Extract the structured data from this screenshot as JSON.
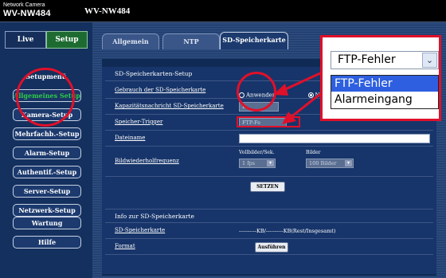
{
  "brand": {
    "sub": "Network Camera",
    "model": "WV-NW484"
  },
  "page_title": "WV-NW484",
  "mode": {
    "live": "Live",
    "setup": "Setup"
  },
  "nav": {
    "heading": "Setupmenü",
    "items": [
      {
        "label": "Allgemeines Setup"
      },
      {
        "label": "Kamera-Setup"
      },
      {
        "label": "Mehrfachb.-Setup"
      },
      {
        "label": "Alarm-Setup"
      },
      {
        "label": "Authentif.-Setup"
      },
      {
        "label": "Server-Setup"
      },
      {
        "label": "Netzwerk-Setup"
      },
      {
        "label": "Wartung"
      }
    ],
    "help": "Hilfe"
  },
  "tabs": [
    {
      "label": "Allgemein"
    },
    {
      "label": "NTP"
    },
    {
      "label": "SD-Speicherkarte"
    }
  ],
  "sd_setup": {
    "heading": "SD-Speicherkarten-Setup",
    "use_label": "Gebrauch der SD-Speicherkarte",
    "use_on": "Anwenden",
    "use_off": "Nicht",
    "capacity_label": "Kapazitätsnachricht SD-Speicherkarte",
    "capacity_value": "B",
    "trigger_label": "Speicher-Trigger",
    "trigger_value": "FTP-Fe",
    "filename_label": "Dateiname",
    "filename_value": "",
    "rate_label": "Bildwiederholfrequenz",
    "fps_header": "Vollbilder/Sek.",
    "fps_value": "1 fps",
    "images_header": "Bilder",
    "images_value": "100 Bilder",
    "set_button": "SETZEN"
  },
  "sd_info": {
    "heading": "Info zur SD-Speicherkarte",
    "card_label": "SD-Speicherkarte",
    "card_value": "----------KB/----------KB(Rest/Insgesamt)",
    "format_label": "Format",
    "format_button": "Ausführen"
  },
  "callout": {
    "selected": "FTP-Fehler",
    "options": [
      "FTP-Fehler",
      "Alarmeingang"
    ]
  }
}
